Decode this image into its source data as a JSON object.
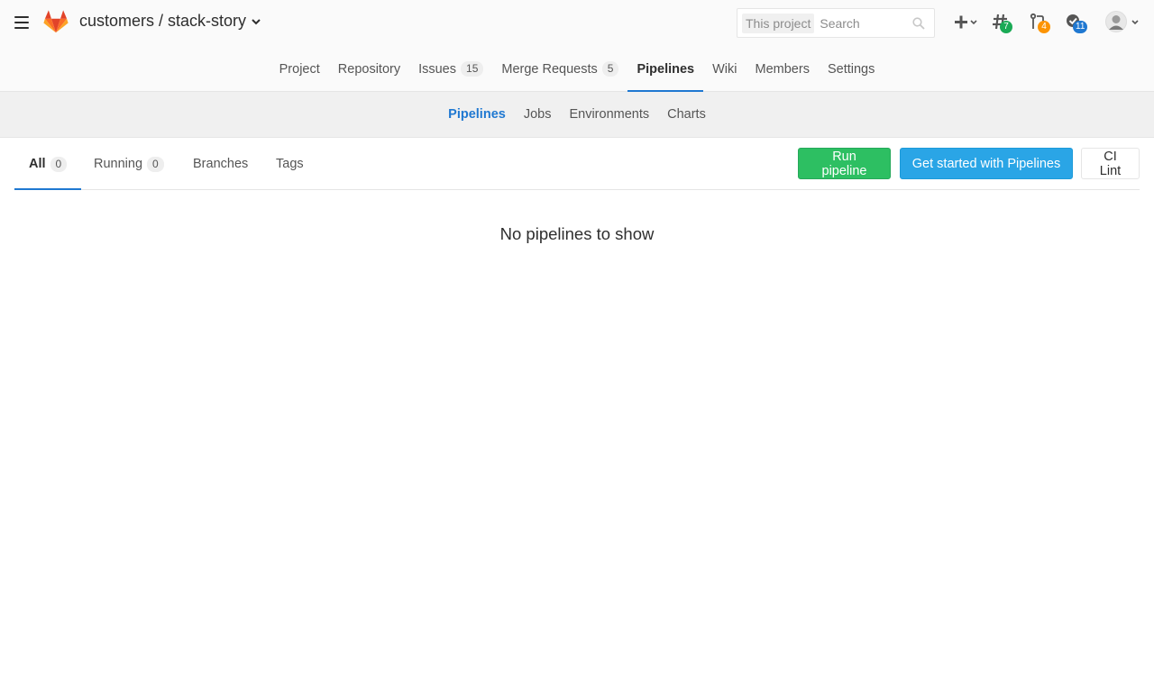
{
  "header": {
    "project_path": "customers / stack-story",
    "search": {
      "scope": "This project",
      "placeholder": "Search"
    },
    "badges": {
      "issues": "7",
      "merge_requests": "4",
      "todos": "11"
    },
    "colors": {
      "badge_green": "#1aaa55",
      "badge_orange": "#fc9403",
      "badge_blue": "#1f78d1"
    }
  },
  "nav": {
    "items": [
      {
        "label": "Project"
      },
      {
        "label": "Repository"
      },
      {
        "label": "Issues",
        "count": "15"
      },
      {
        "label": "Merge Requests",
        "count": "5"
      },
      {
        "label": "Pipelines",
        "active": true
      },
      {
        "label": "Wiki"
      },
      {
        "label": "Members"
      },
      {
        "label": "Settings"
      }
    ]
  },
  "subnav": {
    "items": [
      {
        "label": "Pipelines",
        "active": true
      },
      {
        "label": "Jobs"
      },
      {
        "label": "Environments"
      },
      {
        "label": "Charts"
      }
    ]
  },
  "tabs": {
    "items": [
      {
        "label": "All",
        "count": "0",
        "active": true
      },
      {
        "label": "Running",
        "count": "0"
      },
      {
        "label": "Branches"
      },
      {
        "label": "Tags"
      }
    ]
  },
  "actions": {
    "run_pipeline": "Run pipeline",
    "get_started": "Get started with Pipelines",
    "ci_lint": "CI Lint"
  },
  "empty_state": "No pipelines to show",
  "accent": "#1f78d1"
}
